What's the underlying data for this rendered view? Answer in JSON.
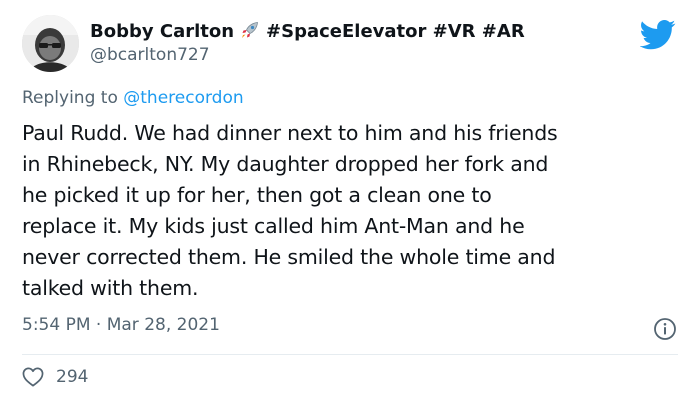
{
  "author": {
    "name": "Bobby Carlton",
    "name_suffix": "#SpaceElevator #VR #AR",
    "handle": "@bcarlton727",
    "avatar_icon": "profile-photo"
  },
  "reply": {
    "prefix": "Replying to ",
    "mention": "@therecordon"
  },
  "tweet": {
    "lines": [
      "Paul Rudd. We had dinner next to him and his friends",
      "in Rhinebeck, NY. My daughter dropped her fork and",
      "he picked it up for her, then got a clean one to",
      "replace it. My kids just called him Ant-Man and he",
      "never corrected them. He smiled the whole time and",
      "talked with them."
    ]
  },
  "meta": {
    "timestamp": "5:54 PM · Mar 28, 2021"
  },
  "engagement": {
    "likes": "294"
  },
  "colors": {
    "brand_blue": "#1d9bf0",
    "secondary_text": "#536471",
    "primary_text": "#0f1419"
  },
  "icons": {
    "brand": "twitter-bird-icon",
    "rocket": "rocket-icon",
    "info": "info-icon",
    "like": "heart-icon"
  }
}
